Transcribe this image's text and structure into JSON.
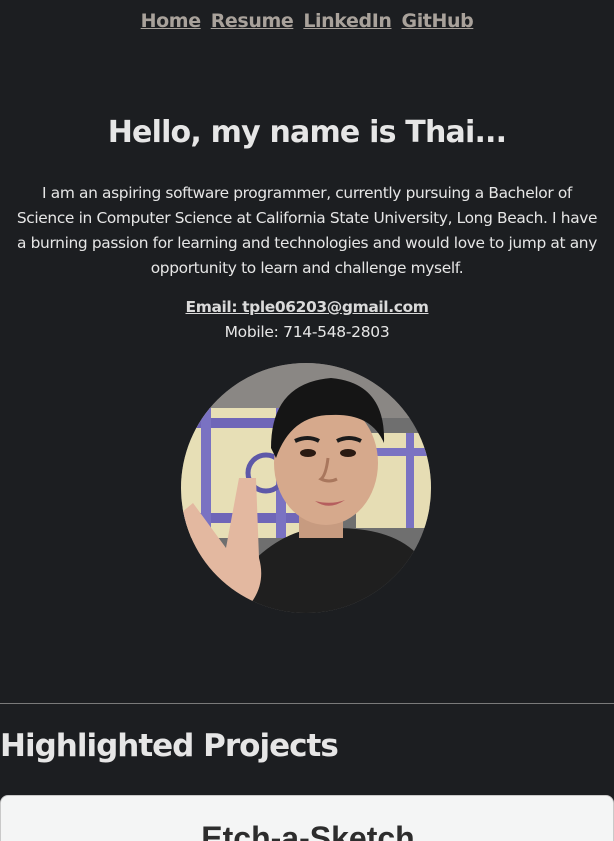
{
  "nav": {
    "links": [
      {
        "label": "Home"
      },
      {
        "label": "Resume"
      },
      {
        "label": "LinkedIn"
      },
      {
        "label": "GitHub"
      }
    ]
  },
  "hero": {
    "title": "Hello, my name is Thai...",
    "intro": "I am an aspiring software programmer, currently pursuing a Bachelor of Science in Computer Science at California State University, Long Beach. I have a burning passion for learning and technologies and would love to jump at any opportunity to learn and challenge myself.",
    "email_label": "Email: tple06203@gmail.com",
    "mobile": "Mobile: 714-548-2803"
  },
  "projects": {
    "heading": "Highlighted Projects",
    "items": [
      {
        "title": "Etch-a-Sketch"
      }
    ]
  },
  "colors": {
    "background": "#1c1e21",
    "nav_link": "#a9a29b",
    "card_background": "#f4f5f5"
  }
}
